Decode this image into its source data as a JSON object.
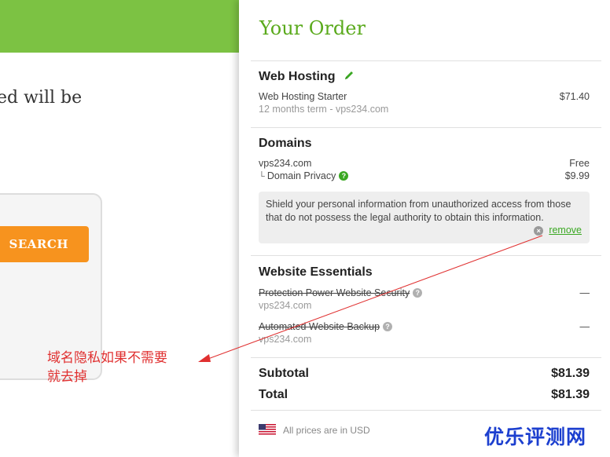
{
  "left": {
    "cropped_text": "ed will be",
    "search_label": "SEARCH",
    "annotation_line1": "域名隐私如果不需要",
    "annotation_line2": "就去掉"
  },
  "order": {
    "title": "Your Order",
    "hosting": {
      "title": "Web Hosting",
      "plan": "Web Hosting Starter",
      "price": "$71.40",
      "term": "12 months term - vps234.com"
    },
    "domains": {
      "title": "Domains",
      "domain": "vps234.com",
      "domain_price": "Free",
      "privacy_label": "Domain Privacy",
      "privacy_price": "$9.99",
      "info_text": "Shield your personal information from unauthorized access from those that do not possess the legal authority to obtain this information.",
      "remove_label": "remove"
    },
    "essentials": {
      "title": "Website Essentials",
      "items": [
        {
          "name": "Protection Power Website Security",
          "domain": "vps234.com",
          "price": "—"
        },
        {
          "name": "Automated Website Backup",
          "domain": "vps234.com",
          "price": "—"
        }
      ]
    },
    "subtotal_label": "Subtotal",
    "subtotal_value": "$81.39",
    "total_label": "Total",
    "total_value": "$81.39",
    "currency_note": "All prices are in USD"
  },
  "watermark": "优乐评测网",
  "colors": {
    "brand_green": "#7cc243",
    "title_green": "#5aaa1c",
    "search_orange": "#f7931e",
    "annotation_red": "#e03030",
    "watermark_blue": "#1c3fcf"
  }
}
